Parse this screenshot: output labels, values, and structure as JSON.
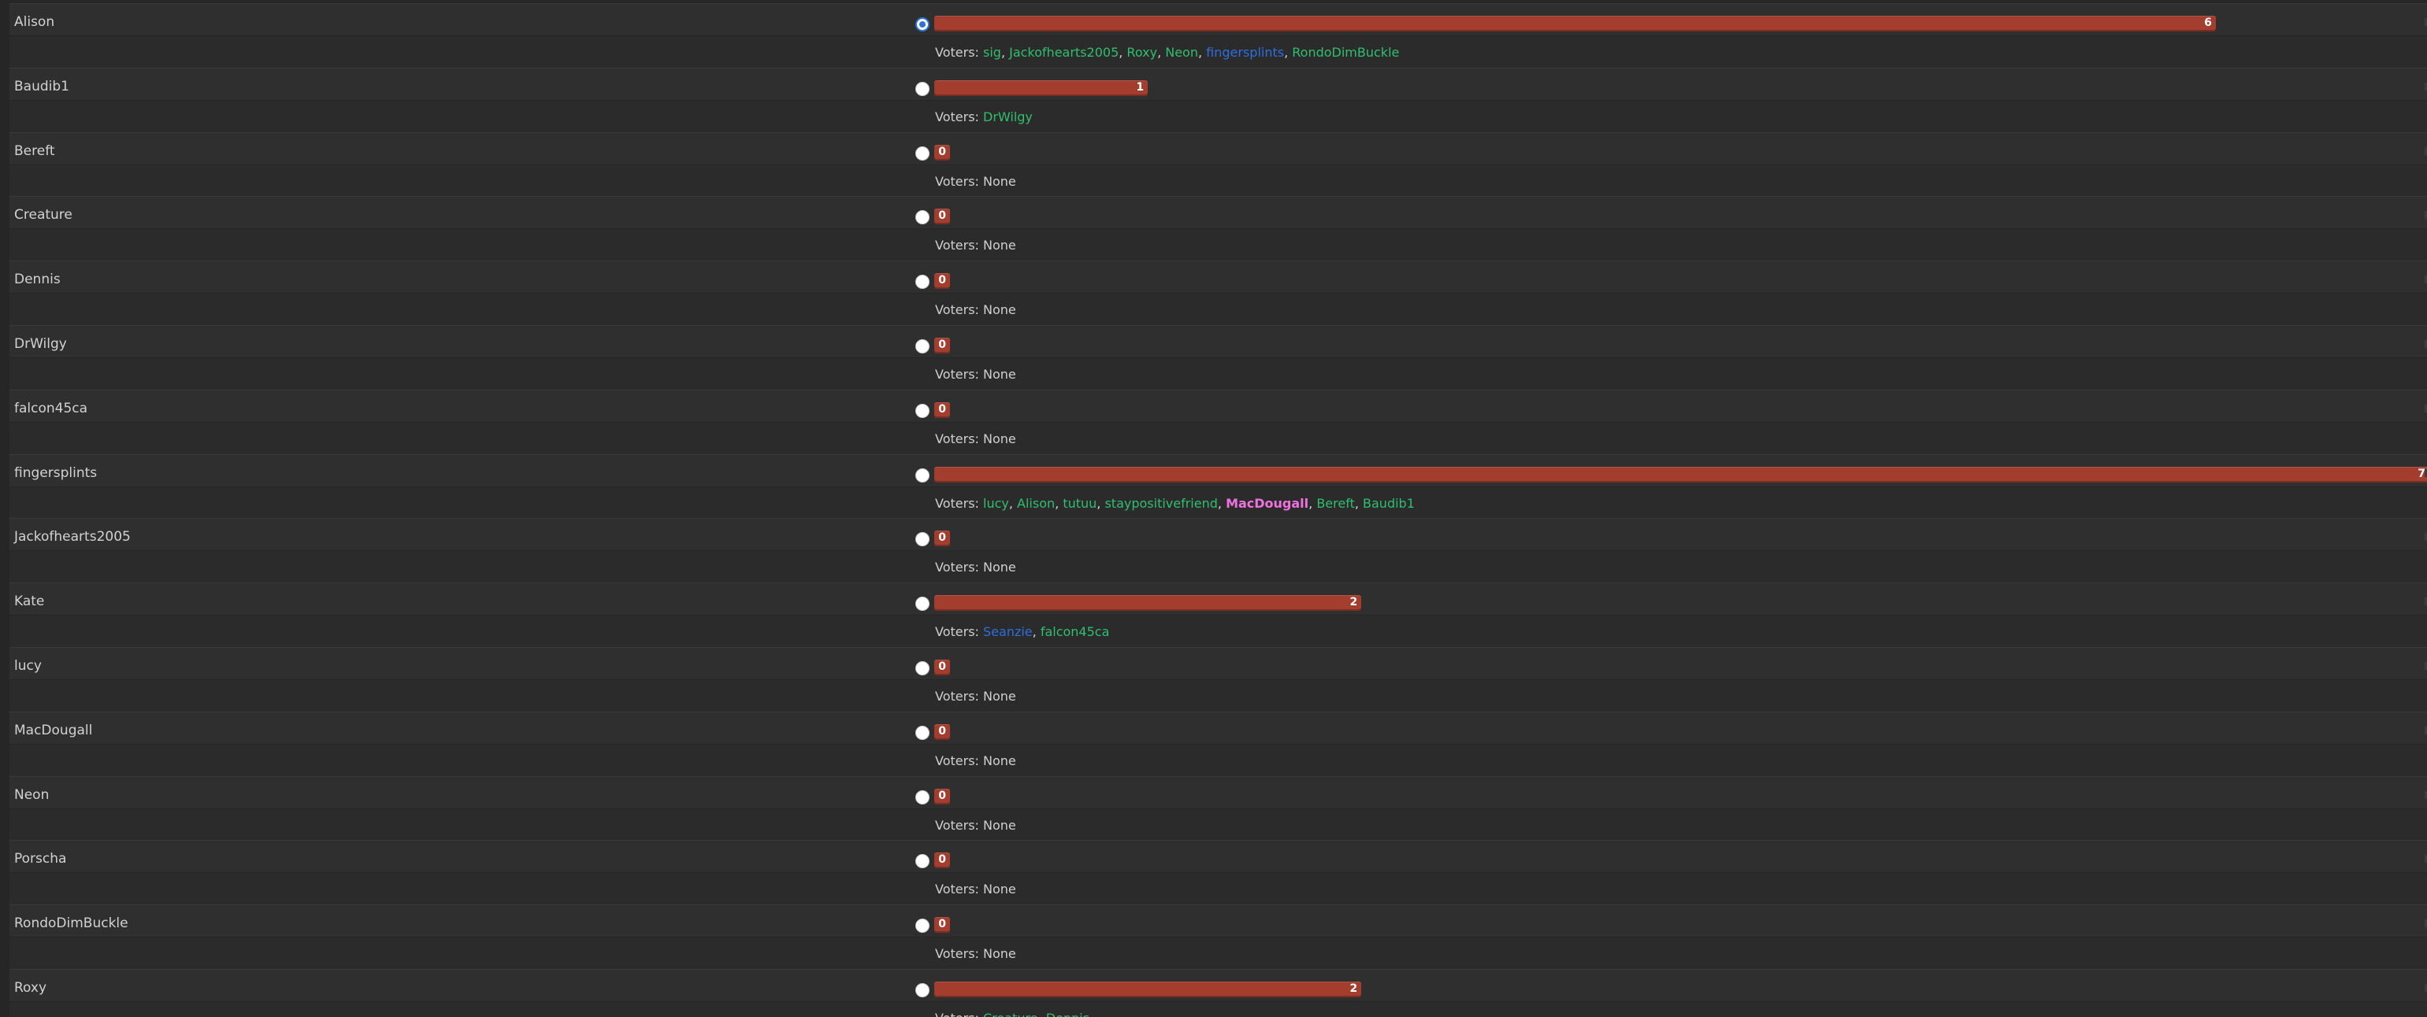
{
  "voters_prefix": "Voters: ",
  "none_label": "None",
  "max_votes": 7,
  "colors": {
    "bar": "#a33e2f",
    "voter_green": "#2fbf6f",
    "voter_blue": "#2d6ee0",
    "voter_pink": "#ef72e0",
    "radio_selected": "#2d73d6"
  },
  "candidates": [
    {
      "name": "Alison",
      "votes": 6,
      "selected": true,
      "voters": [
        {
          "name": "sig",
          "color": "green"
        },
        {
          "name": "Jackofhearts2005",
          "color": "green"
        },
        {
          "name": "Roxy",
          "color": "green"
        },
        {
          "name": "Neon",
          "color": "green"
        },
        {
          "name": "fingersplints",
          "color": "blue"
        },
        {
          "name": "RondoDimBuckle",
          "color": "green"
        }
      ]
    },
    {
      "name": "Baudib1",
      "votes": 1,
      "selected": false,
      "voters": [
        {
          "name": "DrWilgy",
          "color": "green"
        }
      ]
    },
    {
      "name": "Bereft",
      "votes": 0,
      "selected": false,
      "voters": []
    },
    {
      "name": "Creature",
      "votes": 0,
      "selected": false,
      "voters": []
    },
    {
      "name": "Dennis",
      "votes": 0,
      "selected": false,
      "voters": []
    },
    {
      "name": "DrWilgy",
      "votes": 0,
      "selected": false,
      "voters": []
    },
    {
      "name": "falcon45ca",
      "votes": 0,
      "selected": false,
      "voters": []
    },
    {
      "name": "fingersplints",
      "votes": 7,
      "selected": false,
      "voters": [
        {
          "name": "lucy",
          "color": "green"
        },
        {
          "name": "Alison",
          "color": "green"
        },
        {
          "name": "tutuu",
          "color": "green"
        },
        {
          "name": "staypositivefriend",
          "color": "green"
        },
        {
          "name": "MacDougall",
          "color": "pink"
        },
        {
          "name": "Bereft",
          "color": "green"
        },
        {
          "name": "Baudib1",
          "color": "green"
        }
      ]
    },
    {
      "name": "Jackofhearts2005",
      "votes": 0,
      "selected": false,
      "voters": []
    },
    {
      "name": "Kate",
      "votes": 2,
      "selected": false,
      "voters": [
        {
          "name": "Seanzie",
          "color": "blue"
        },
        {
          "name": "falcon45ca",
          "color": "green"
        }
      ]
    },
    {
      "name": "lucy",
      "votes": 0,
      "selected": false,
      "voters": []
    },
    {
      "name": "MacDougall",
      "votes": 0,
      "selected": false,
      "voters": []
    },
    {
      "name": "Neon",
      "votes": 0,
      "selected": false,
      "voters": []
    },
    {
      "name": "Porscha",
      "votes": 0,
      "selected": false,
      "voters": []
    },
    {
      "name": "RondoDimBuckle",
      "votes": 0,
      "selected": false,
      "voters": []
    },
    {
      "name": "Roxy",
      "votes": 2,
      "selected": false,
      "voters": [
        {
          "name": "Creature",
          "color": "green"
        },
        {
          "name": "Dennis",
          "color": "green"
        }
      ]
    }
  ]
}
